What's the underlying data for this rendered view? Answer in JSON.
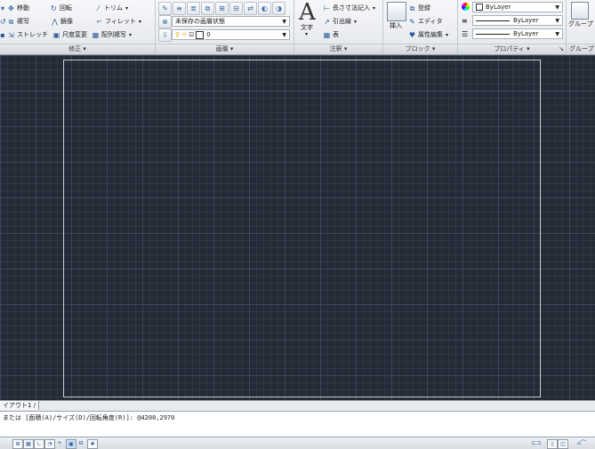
{
  "modify": {
    "move": "移動",
    "rotate": "回転",
    "trim": "トリム",
    "copy": "複写",
    "mirror": "鏡像",
    "fillet": "フィレット",
    "stretch": "ストレッチ",
    "scale": "尺度変更",
    "array": "配列複写",
    "title": "修正"
  },
  "layers": {
    "state": "未保存の画層状態",
    "current": "0",
    "title": "画層"
  },
  "annotation": {
    "text_label": "文字",
    "dimension": "長さ寸法記入",
    "leader": "引出線",
    "table": "表",
    "title": "注釈"
  },
  "block": {
    "insert": "挿入",
    "create": "登録",
    "editor": "エディタ",
    "attribute": "属性編集",
    "title": "ブロック"
  },
  "properties": {
    "color": "ByLayer",
    "linetype": "ByLayer",
    "lineweight": "ByLayer",
    "title": "プロパティ"
  },
  "groups": {
    "group_label": "グループ",
    "title": "グループ"
  },
  "layout_tab": "イアウト1",
  "command_line": "または [面積(A)/サイズ(D)/回転角度(R)]: @4200,2970",
  "colors": {
    "canvas_bg": "#252b36",
    "ribbon_bg": "#eef0f3",
    "accent": "#2a5a9a"
  }
}
